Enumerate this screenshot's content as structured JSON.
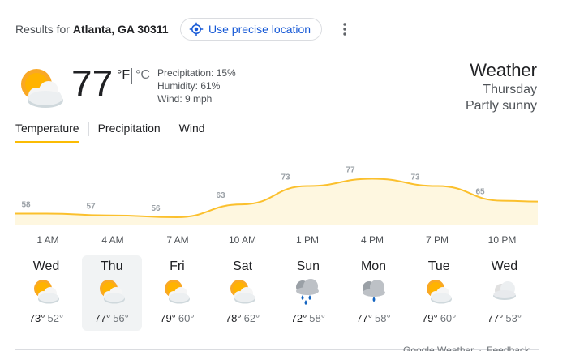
{
  "location": {
    "prefix": "Results for ",
    "name": "Atlanta, GA 30311"
  },
  "precise_location_label": "Use precise location",
  "current": {
    "icon": "partly-cloudy-icon",
    "temp": "77",
    "unit_f": "°F",
    "unit_c": "°C",
    "precipitation": "Precipitation: 15%",
    "humidity": "Humidity: 61%",
    "wind": "Wind: 9 mph"
  },
  "header": {
    "title": "Weather",
    "day": "Thursday",
    "condition": "Partly sunny"
  },
  "tabs": [
    {
      "label": "Temperature",
      "active": true
    },
    {
      "label": "Precipitation",
      "active": false
    },
    {
      "label": "Wind",
      "active": false
    }
  ],
  "chart_data": {
    "type": "area",
    "title": "",
    "xlabel": "",
    "ylabel": "",
    "x": [
      "1 AM",
      "4 AM",
      "7 AM",
      "10 AM",
      "1 PM",
      "4 PM",
      "7 PM",
      "10 PM"
    ],
    "series": [
      {
        "values": [
          58,
          57,
          56,
          63,
          73,
          77,
          73,
          65
        ]
      }
    ],
    "colors": {
      "line": "#fbc02d",
      "fill": "#fef7e0"
    }
  },
  "forecast": [
    {
      "day": "Wed",
      "icon": "partly-cloudy-icon",
      "hi": "73°",
      "lo": "52°"
    },
    {
      "day": "Thu",
      "icon": "partly-cloudy-icon",
      "hi": "77°",
      "lo": "56°",
      "selected": true
    },
    {
      "day": "Fri",
      "icon": "partly-cloudy-icon",
      "hi": "79°",
      "lo": "60°"
    },
    {
      "day": "Sat",
      "icon": "partly-cloudy-icon",
      "hi": "78°",
      "lo": "62°"
    },
    {
      "day": "Sun",
      "icon": "showers-icon",
      "hi": "72°",
      "lo": "58°"
    },
    {
      "day": "Mon",
      "icon": "rain-icon",
      "hi": "77°",
      "lo": "58°"
    },
    {
      "day": "Tue",
      "icon": "partly-cloudy-icon",
      "hi": "79°",
      "lo": "60°"
    },
    {
      "day": "Wed",
      "icon": "cloudy-icon",
      "hi": "77°",
      "lo": "53°"
    }
  ],
  "footer": {
    "source": "Google Weather",
    "separator": "·",
    "feedback": "Feedback"
  },
  "colors": {
    "accent": "#fbbc04",
    "link": "#1558d6"
  }
}
